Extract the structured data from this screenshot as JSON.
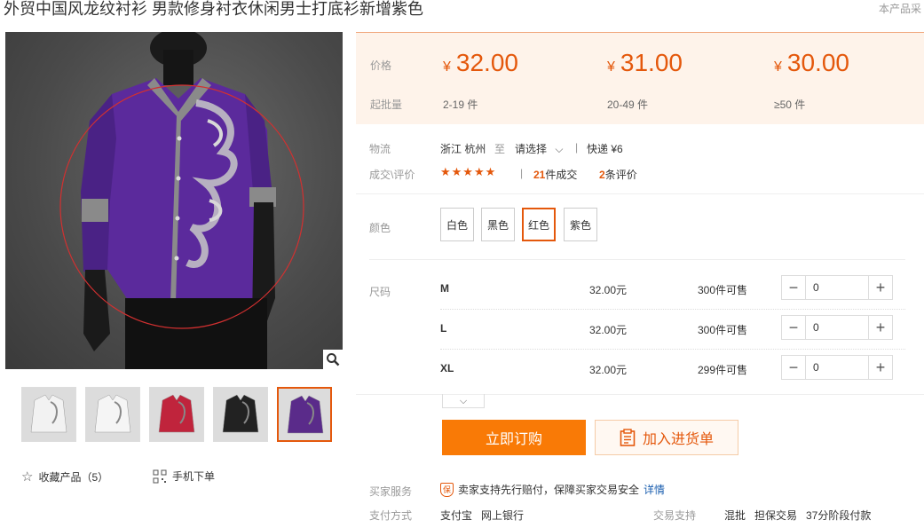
{
  "product": {
    "title": "外贸中国风龙纹衬衫 男款修身衬衣休闲男士打底衫新增紫色",
    "title_right": "本产品采"
  },
  "gallery": {
    "thumbnails": [
      {
        "name": "white-shirt-front",
        "color": "#f2f2f2"
      },
      {
        "name": "white-shirt-side",
        "color": "#f5f5f5"
      },
      {
        "name": "red-shirt",
        "color": "#c0243c"
      },
      {
        "name": "black-shirt",
        "color": "#222222"
      },
      {
        "name": "purple-shirt",
        "color": "#5a2b8a"
      }
    ],
    "active_index": 4,
    "favorite_label": "收藏产品（5）",
    "mobile_order_label": "手机下单"
  },
  "pricing": {
    "price_label": "价格",
    "moq_label": "起批量",
    "currency": "¥",
    "tiers": [
      {
        "price": "32.00",
        "moq": "2-19 件"
      },
      {
        "price": "31.00",
        "moq": "20-49 件"
      },
      {
        "price": "30.00",
        "moq": "≥50 件"
      }
    ]
  },
  "logistics": {
    "label": "物流",
    "origin": "浙江 杭州",
    "to": "至",
    "destination": "请选择",
    "sep": "|",
    "express": "快递 ¥6"
  },
  "reviews": {
    "label": "成交\\评价",
    "stars": "★★★★★",
    "sep": "|",
    "sold_count": "21",
    "sold_suffix": "件成交",
    "review_count": "2",
    "review_suffix": "条评价"
  },
  "color": {
    "label": "颜色",
    "options": [
      "白色",
      "黑色",
      "红色",
      "紫色"
    ],
    "selected_index": 2
  },
  "size": {
    "label": "尺码",
    "rows": [
      {
        "name": "M",
        "price": "32.00元",
        "stock": "300件可售",
        "qty": "0"
      },
      {
        "name": "L",
        "price": "32.00元",
        "stock": "300件可售",
        "qty": "0"
      },
      {
        "name": "XL",
        "price": "32.00元",
        "stock": "299件可售",
        "qty": "0"
      }
    ]
  },
  "actions": {
    "order_now": "立即订购",
    "add_to_list": "加入进货单"
  },
  "service": {
    "buyer_label": "买家服务",
    "badge": "保",
    "buyer_text": "卖家支持先行赔付，保障买家交易安全",
    "detail_link": "详情",
    "payment_label": "支付方式",
    "payment_methods": "支付宝   网上银行",
    "trade_label": "交易支持",
    "trade_methods": "混批   担保交易   37分阶段付款"
  },
  "colors": {
    "accent": "#e4580c",
    "button": "#f97a06",
    "price_bg": "#fef3ea",
    "link": "#1a5eaf"
  }
}
